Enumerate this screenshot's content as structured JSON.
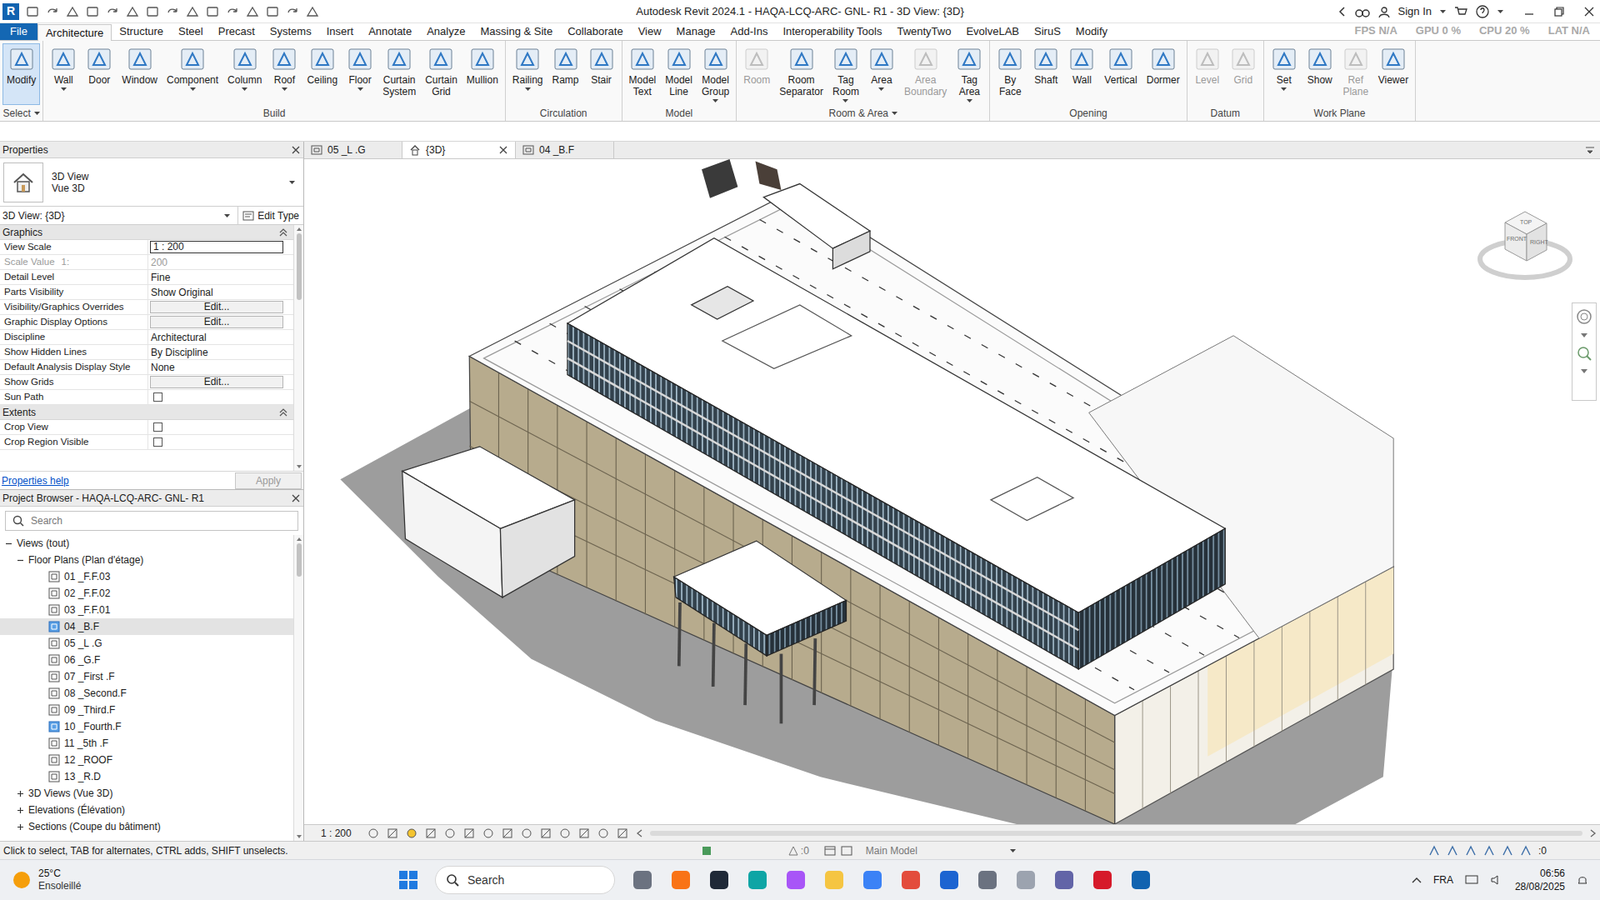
{
  "window": {
    "title": "Autodesk Revit 2024.1 - HAQA-LCQ-ARC- GNL- R1 - 3D View: {3D}",
    "app_logo": "R",
    "sign_in": "Sign In"
  },
  "perf_overlay": [
    "FPS N/A",
    "GPU 0 %",
    "CPU 20 %",
    "LAT N/A"
  ],
  "ribbon_tabs": [
    {
      "label": "File",
      "selected": false,
      "kind": "file"
    },
    {
      "label": "Architecture",
      "selected": true,
      "kind": "tab"
    },
    {
      "label": "Structure",
      "selected": false,
      "kind": "tab"
    },
    {
      "label": "Steel",
      "selected": false,
      "kind": "tab"
    },
    {
      "label": "Precast",
      "selected": false,
      "kind": "tab"
    },
    {
      "label": "Systems",
      "selected": false,
      "kind": "tab"
    },
    {
      "label": "Insert",
      "selected": false,
      "kind": "tab"
    },
    {
      "label": "Annotate",
      "selected": false,
      "kind": "tab"
    },
    {
      "label": "Analyze",
      "selected": false,
      "kind": "tab"
    },
    {
      "label": "Massing & Site",
      "selected": false,
      "kind": "tab"
    },
    {
      "label": "Collaborate",
      "selected": false,
      "kind": "tab"
    },
    {
      "label": "View",
      "selected": false,
      "kind": "tab"
    },
    {
      "label": "Manage",
      "selected": false,
      "kind": "tab"
    },
    {
      "label": "Add-Ins",
      "selected": false,
      "kind": "tab"
    },
    {
      "label": "Interoperability Tools",
      "selected": false,
      "kind": "tab"
    },
    {
      "label": "TwentyTwo",
      "selected": false,
      "kind": "tab"
    },
    {
      "label": "EvolveLAB",
      "selected": false,
      "kind": "tab"
    },
    {
      "label": "SiruS",
      "selected": false,
      "kind": "tab"
    },
    {
      "label": "Modify",
      "selected": false,
      "kind": "tab"
    }
  ],
  "ribbon_panels": [
    {
      "label": "Select",
      "dropdown": true,
      "buttons": [
        {
          "label": "Modify",
          "active": true,
          "disabled": false,
          "dropdown": false
        }
      ]
    },
    {
      "label": "Build",
      "dropdown": false,
      "buttons": [
        {
          "label": "Wall",
          "active": false,
          "disabled": false,
          "dropdown": true
        },
        {
          "label": "Door",
          "active": false,
          "disabled": false,
          "dropdown": false
        },
        {
          "label": "Window",
          "active": false,
          "disabled": false,
          "dropdown": false
        },
        {
          "label": "Component",
          "active": false,
          "disabled": false,
          "dropdown": true
        },
        {
          "label": "Column",
          "active": false,
          "disabled": false,
          "dropdown": true
        },
        {
          "label": "Roof",
          "active": false,
          "disabled": false,
          "dropdown": true
        },
        {
          "label": "Ceiling",
          "active": false,
          "disabled": false,
          "dropdown": false
        },
        {
          "label": "Floor",
          "active": false,
          "disabled": false,
          "dropdown": true
        },
        {
          "label": "Curtain System",
          "active": false,
          "disabled": false,
          "dropdown": false
        },
        {
          "label": "Curtain Grid",
          "active": false,
          "disabled": false,
          "dropdown": false
        },
        {
          "label": "Mullion",
          "active": false,
          "disabled": false,
          "dropdown": false
        }
      ]
    },
    {
      "label": "Circulation",
      "dropdown": false,
      "buttons": [
        {
          "label": "Railing",
          "active": false,
          "disabled": false,
          "dropdown": true
        },
        {
          "label": "Ramp",
          "active": false,
          "disabled": false,
          "dropdown": false
        },
        {
          "label": "Stair",
          "active": false,
          "disabled": false,
          "dropdown": false
        }
      ]
    },
    {
      "label": "Model",
      "dropdown": false,
      "buttons": [
        {
          "label": "Model Text",
          "active": false,
          "disabled": false,
          "dropdown": false
        },
        {
          "label": "Model Line",
          "active": false,
          "disabled": false,
          "dropdown": false
        },
        {
          "label": "Model Group",
          "active": false,
          "disabled": false,
          "dropdown": true
        }
      ]
    },
    {
      "label": "Room & Area",
      "dropdown": true,
      "buttons": [
        {
          "label": "Room",
          "active": false,
          "disabled": true,
          "dropdown": false
        },
        {
          "label": "Room Separator",
          "active": false,
          "disabled": false,
          "dropdown": false
        },
        {
          "label": "Tag Room",
          "active": false,
          "disabled": false,
          "dropdown": true
        },
        {
          "label": "Area",
          "active": false,
          "disabled": false,
          "dropdown": true
        },
        {
          "label": "Area Boundary",
          "active": false,
          "disabled": true,
          "dropdown": false
        },
        {
          "label": "Tag Area",
          "active": false,
          "disabled": false,
          "dropdown": true
        }
      ]
    },
    {
      "label": "Opening",
      "dropdown": false,
      "buttons": [
        {
          "label": "By Face",
          "active": false,
          "disabled": false,
          "dropdown": false
        },
        {
          "label": "Shaft",
          "active": false,
          "disabled": false,
          "dropdown": false
        },
        {
          "label": "Wall",
          "active": false,
          "disabled": false,
          "dropdown": false
        },
        {
          "label": "Vertical",
          "active": false,
          "disabled": false,
          "dropdown": false
        },
        {
          "label": "Dormer",
          "active": false,
          "disabled": false,
          "dropdown": false
        }
      ]
    },
    {
      "label": "Datum",
      "dropdown": false,
      "buttons": [
        {
          "label": "Level",
          "active": false,
          "disabled": true,
          "dropdown": false
        },
        {
          "label": "Grid",
          "active": false,
          "disabled": true,
          "dropdown": false
        }
      ]
    },
    {
      "label": "Work Plane",
      "dropdown": false,
      "buttons": [
        {
          "label": "Set",
          "active": false,
          "disabled": false,
          "dropdown": true
        },
        {
          "label": "Show",
          "active": false,
          "disabled": false,
          "dropdown": false
        },
        {
          "label": "Ref Plane",
          "active": false,
          "disabled": true,
          "dropdown": false
        },
        {
          "label": "Viewer",
          "active": false,
          "disabled": false,
          "dropdown": false
        }
      ]
    }
  ],
  "properties": {
    "title": "Properties",
    "type_name": "3D View",
    "type_sub": "Vue 3D",
    "instance": "3D View: {3D}",
    "edit_type": "Edit Type",
    "groups": [
      {
        "label": "Graphics",
        "expanded": true,
        "rows": [
          {
            "name": "View Scale",
            "kind": "input",
            "value": "1 : 200",
            "disabled": false
          },
          {
            "name": "Scale Value",
            "suffix": "1:",
            "kind": "text",
            "value": "200",
            "disabled": true
          },
          {
            "name": "Detail Level",
            "kind": "text",
            "value": "Fine",
            "disabled": false
          },
          {
            "name": "Parts Visibility",
            "kind": "text",
            "value": "Show Original",
            "disabled": false
          },
          {
            "name": "Visibility/Graphics Overrides",
            "kind": "button",
            "value": "Edit...",
            "disabled": false
          },
          {
            "name": "Graphic Display Options",
            "kind": "button",
            "value": "Edit...",
            "disabled": false
          },
          {
            "name": "Discipline",
            "kind": "text",
            "value": "Architectural",
            "disabled": false
          },
          {
            "name": "Show Hidden Lines",
            "kind": "text",
            "value": "By Discipline",
            "disabled": false
          },
          {
            "name": "Default Analysis Display Style",
            "kind": "text",
            "value": "None",
            "disabled": false
          },
          {
            "name": "Show Grids",
            "kind": "button",
            "value": "Edit...",
            "disabled": false
          },
          {
            "name": "Sun Path",
            "kind": "checkbox",
            "checked": false,
            "disabled": false
          }
        ]
      },
      {
        "label": "Extents",
        "expanded": true,
        "rows": [
          {
            "name": "Crop View",
            "kind": "checkbox",
            "checked": false,
            "disabled": false
          },
          {
            "name": "Crop Region Visible",
            "kind": "checkbox",
            "checked": false,
            "disabled": false
          }
        ]
      }
    ],
    "help": "Properties help",
    "apply": "Apply",
    "apply_disabled": true
  },
  "browser": {
    "title": "Project Browser - HAQA-LCQ-ARC- GNL- R1",
    "search_placeholder": "Search",
    "items": [
      {
        "label": "Views (tout)",
        "level": 0,
        "kind": "group",
        "expanded": true,
        "selected": false
      },
      {
        "label": "Floor Plans (Plan d'étage)",
        "level": 1,
        "kind": "group",
        "expanded": true,
        "selected": false
      },
      {
        "label": "01 _F.F.03",
        "level": 2,
        "kind": "view",
        "open": false,
        "selected": false
      },
      {
        "label": "02 _F.F.02",
        "level": 2,
        "kind": "view",
        "open": false,
        "selected": false
      },
      {
        "label": "03 _F.F.01",
        "level": 2,
        "kind": "view",
        "open": false,
        "selected": false
      },
      {
        "label": "04 _B.F",
        "level": 2,
        "kind": "view",
        "open": true,
        "selected": true
      },
      {
        "label": "05 _L .G",
        "level": 2,
        "kind": "view",
        "open": false,
        "selected": false
      },
      {
        "label": "06 _G.F",
        "level": 2,
        "kind": "view",
        "open": false,
        "selected": false
      },
      {
        "label": "07 _First .F",
        "level": 2,
        "kind": "view",
        "open": false,
        "selected": false
      },
      {
        "label": "08 _Second.F",
        "level": 2,
        "kind": "view",
        "open": false,
        "selected": false
      },
      {
        "label": "09 _Third.F",
        "level": 2,
        "kind": "view",
        "open": false,
        "selected": false
      },
      {
        "label": "10 _Fourth.F",
        "level": 2,
        "kind": "view",
        "open": true,
        "selected": false
      },
      {
        "label": "11 _5th .F",
        "level": 2,
        "kind": "view",
        "open": false,
        "selected": false
      },
      {
        "label": "12 _ROOF",
        "level": 2,
        "kind": "view",
        "open": false,
        "selected": false
      },
      {
        "label": "13 _R.D",
        "level": 2,
        "kind": "view",
        "open": false,
        "selected": false
      },
      {
        "label": "3D Views (Vue 3D)",
        "level": 1,
        "kind": "group",
        "expanded": false,
        "selected": false
      },
      {
        "label": "Elevations (Élévation)",
        "level": 1,
        "kind": "group",
        "expanded": false,
        "selected": false
      },
      {
        "label": "Sections (Coupe du bâtiment)",
        "level": 1,
        "kind": "group",
        "expanded": false,
        "selected": false
      }
    ]
  },
  "view_tabs": [
    {
      "label": "05 _L .G",
      "kind": "plan",
      "selected": false
    },
    {
      "label": "{3D}",
      "kind": "3d",
      "selected": true
    },
    {
      "label": "04 _B.F",
      "kind": "plan",
      "selected": false
    }
  ],
  "view_cube": {
    "top": "TOP",
    "front": "FRONT",
    "right": "RIGHT"
  },
  "view_control": {
    "scale": "1 : 200"
  },
  "status_bar": {
    "hint": "Click to select, TAB for alternates, CTRL adds, SHIFT unselects.",
    "worksharing_count": ":0",
    "model": "Main Model",
    "filter_count": ":0"
  },
  "taskbar": {
    "weather": {
      "temp": "25°C",
      "condition": "Ensoleillé"
    },
    "search": "Search",
    "language": "FRA",
    "time": "06:56",
    "date": "28/08/2025"
  }
}
